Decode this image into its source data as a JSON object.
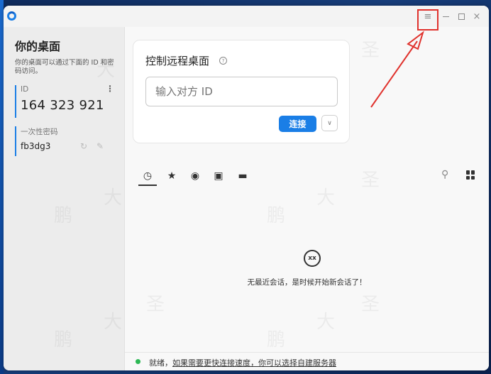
{
  "window": {
    "controls": {
      "menu_glyph": "≡",
      "min_label": "",
      "close_glyph": "×"
    }
  },
  "sidebar": {
    "title": "你的桌面",
    "description": "你的桌面可以通过下面的 ID 和密码访问。",
    "id_label": "ID",
    "id_more": "⋮",
    "id_value": "164 323 921",
    "password_label": "一次性密码",
    "password_value": "fb3dg3"
  },
  "control_card": {
    "title": "控制远程桌面",
    "help_glyph": "?",
    "input_placeholder": "输入对方 ID",
    "connect_label": "连接",
    "dropdown_glyph": "∨"
  },
  "tabs": {
    "items": [
      {
        "name": "recent",
        "glyph": "◷"
      },
      {
        "name": "favorites",
        "glyph": "★"
      },
      {
        "name": "discovered",
        "glyph": "◉"
      },
      {
        "name": "address-book",
        "glyph": "▣"
      },
      {
        "name": "group",
        "glyph": "▬"
      }
    ],
    "search_glyph": "⚲"
  },
  "empty_state": {
    "icon_glyph": "xx",
    "message": "无最近会话，是时候开始新会话了！"
  },
  "status_bar": {
    "text_prefix": "就绪，",
    "link_text": "如果需要更快连接速度，你可以选择自建服务器"
  },
  "watermark": {
    "chars": [
      "鹏",
      "大",
      "圣"
    ]
  },
  "colors": {
    "accent": "#1a7ee6",
    "status_ok": "#2db855",
    "annotation": "#e0322d"
  }
}
